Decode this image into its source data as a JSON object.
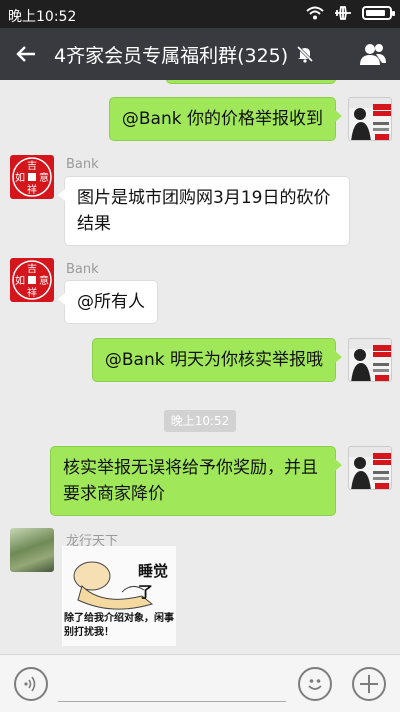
{
  "status_bar": {
    "time": "晚上10:52",
    "battery_level": 0.85
  },
  "header": {
    "title": "4齐家会员专属福利群(325)"
  },
  "messages": [
    {
      "sender": "",
      "text": "@Bank 你的价格举报收到",
      "direction": "out"
    },
    {
      "sender": "Bank",
      "text": "图片是城市团购网3月19日的砍价结果",
      "direction": "in"
    },
    {
      "sender": "Bank",
      "text": "@所有人",
      "direction": "in"
    },
    {
      "sender": "",
      "text": "@Bank 明天为你核实举报哦",
      "direction": "out"
    },
    {
      "sender": "",
      "text": "核实举报无误将给予你奖励，并且要求商家降价",
      "direction": "out"
    },
    {
      "sender": "龙行天下",
      "text": "",
      "direction": "in"
    }
  ],
  "time_separator": "晚上10:52",
  "avatar_bank_chars": [
    "吉",
    "如",
    "意",
    "祥"
  ],
  "sticker": {
    "caption_top": "睡觉了",
    "caption_bottom": "除了给我介绍对象，闲事别打扰我！"
  },
  "colors": {
    "header_bg": "#393a3f",
    "out_bubble": "#a0e75a",
    "in_bubble": "#ffffff",
    "chat_bg": "#ebebeb"
  },
  "icons": [
    "wifi-icon",
    "airplane-icon",
    "battery-icon",
    "back-arrow-icon",
    "mute-icon",
    "group-members-icon",
    "voice-icon",
    "emoji-icon",
    "plus-icon"
  ]
}
